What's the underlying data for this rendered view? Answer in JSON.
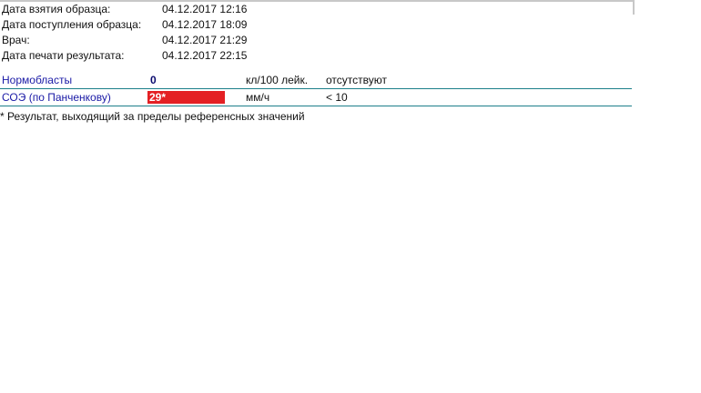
{
  "meta": {
    "rows": [
      {
        "label": "Дата взятия образца:",
        "value": "04.12.2017 12:16"
      },
      {
        "label": "Дата поступления образца:",
        "value": "04.12.2017 18:09"
      },
      {
        "label": "Врач:",
        "value": "04.12.2017 21:29"
      },
      {
        "label": "Дата печати результата:",
        "value": "04.12.2017 22:15"
      }
    ]
  },
  "results": [
    {
      "name": "Нормобласты",
      "value": "0",
      "unit": "кл/100 лейк.",
      "reference": "отсутствуют",
      "abnormal": false
    },
    {
      "name": "СОЭ (по Панченкову)",
      "value": "29*",
      "unit": "мм/ч",
      "reference": "< 10",
      "abnormal": true,
      "flag_color": "#e42024"
    }
  ],
  "footnote": "* Результат, выходящий за пределы референсных значений",
  "colors": {
    "test_name": "#1a1aa6",
    "row_border": "#1d7f8a",
    "abnormal_bg": "#e42024"
  }
}
